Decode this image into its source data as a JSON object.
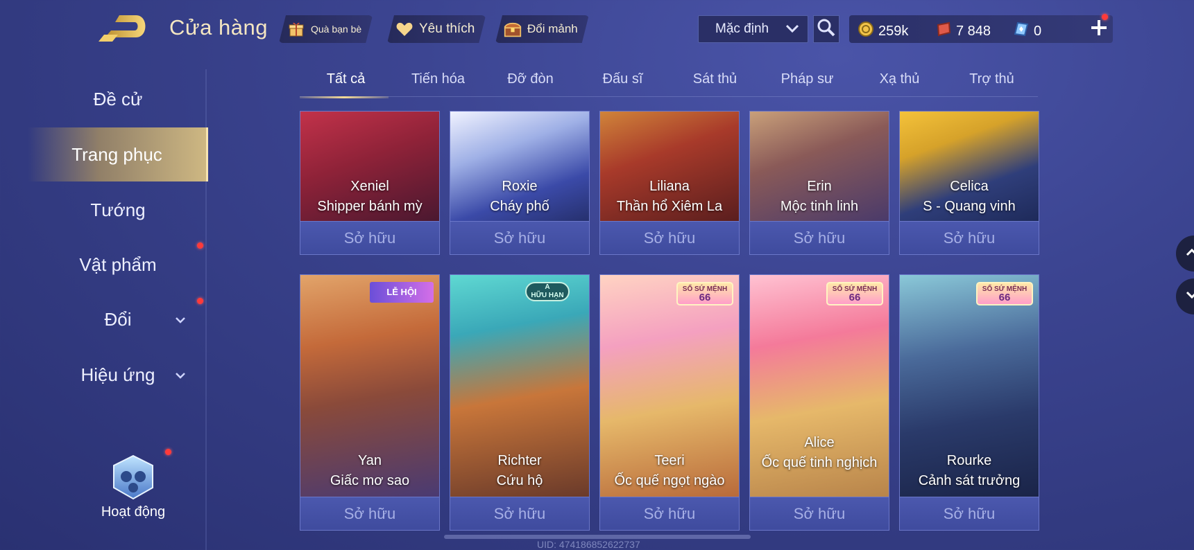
{
  "header": {
    "title": "Cửa hàng",
    "gift_label": "Quà bạn bè",
    "favorite_label": "Yêu thích",
    "exchange_label": "Đổi mảnh",
    "sort_selected": "Mặc định",
    "currency": {
      "gold": "259k",
      "vouchers": "7 848",
      "diamonds": "0"
    }
  },
  "sidebar": {
    "items": [
      {
        "label": "Đề cử"
      },
      {
        "label": "Trang phục"
      },
      {
        "label": "Tướng"
      },
      {
        "label": "Vật phẩm"
      },
      {
        "label": "Đổi"
      },
      {
        "label": "Hiệu ứng"
      }
    ],
    "activity_label": "Hoạt động"
  },
  "tabs": [
    {
      "label": "Tất cả"
    },
    {
      "label": "Tiến hóa"
    },
    {
      "label": "Đỡ đòn"
    },
    {
      "label": "Đấu sĩ"
    },
    {
      "label": "Sát thủ"
    },
    {
      "label": "Pháp sư"
    },
    {
      "label": "Xạ thủ"
    },
    {
      "label": "Trợ thủ"
    }
  ],
  "skins": [
    {
      "hero": "Xeniel",
      "skin": "Shipper bánh mỳ",
      "status": "Sở hữu"
    },
    {
      "hero": "Roxie",
      "skin": "Cháy phố",
      "status": "Sở hữu"
    },
    {
      "hero": "Liliana",
      "skin": "Thần hổ Xiêm La",
      "status": "Sở hữu"
    },
    {
      "hero": "Erin",
      "skin": "Mộc tinh linh",
      "status": "Sở hữu"
    },
    {
      "hero": "Celica",
      "skin": "S - Quang vinh",
      "status": "Sở hữu"
    },
    {
      "hero": "Yan",
      "skin": "Giấc mơ sao",
      "status": "Sở hữu",
      "badge": "LỄ HỘI"
    },
    {
      "hero": "Richter",
      "skin": "Cứu hộ",
      "status": "Sở hữu",
      "badge": "HỮU HẠN",
      "badge_grade": "A"
    },
    {
      "hero": "Teeri",
      "skin": "Ốc quế ngọt ngào",
      "status": "Sở hữu",
      "badge": "SỔ SỨ MỆNH",
      "badge_num": "66"
    },
    {
      "hero": "Alice",
      "skin": "Ốc quế tinh nghịch",
      "status": "Sở hữu",
      "badge": "SỔ SỨ MỆNH",
      "badge_num": "66"
    },
    {
      "hero": "Rourke",
      "skin": "Cảnh sát trưởng",
      "status": "Sở hữu",
      "badge": "SỔ SỨ MỆNH",
      "badge_num": "66"
    }
  ],
  "footer": {
    "uid_text": "UID: 474186852622737"
  },
  "colors": {
    "background": "#3c4592",
    "accent_gold": "#f6dc96",
    "own_button": "#4b58ae",
    "notification": "#ff3a3a"
  }
}
